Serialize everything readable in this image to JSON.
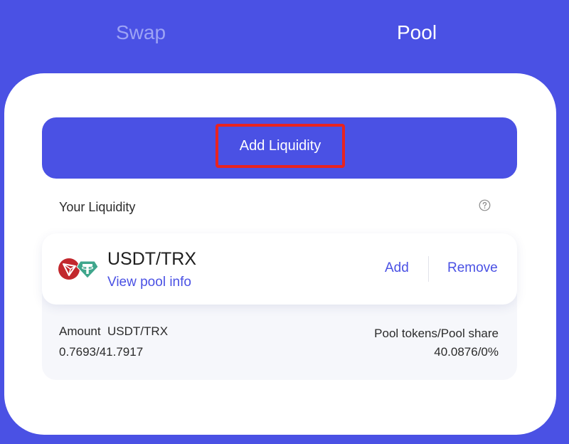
{
  "tabs": {
    "swap_label": "Swap",
    "pool_label": "Pool",
    "active": "Pool"
  },
  "add_liquidity": {
    "label": "Add Liquidity"
  },
  "your_liquidity": {
    "title": "Your Liquidity",
    "help_icon": "question-circle-icon"
  },
  "position": {
    "pair": "USDT/TRX",
    "view_pool_info": "View pool info",
    "add_label": "Add",
    "remove_label": "Remove",
    "token_icons": [
      "trx-token-icon",
      "usdt-token-icon"
    ],
    "amount_label": "Amount  USDT/TRX",
    "amount_value": "0.7693/41.7917",
    "share_label": "Pool tokens/Pool share",
    "share_value": "40.0876/0%"
  },
  "colors": {
    "brand": "#4a51e4",
    "highlight": "#e8231f",
    "trx": "#c2282d",
    "usdt": "#3fa68c"
  }
}
